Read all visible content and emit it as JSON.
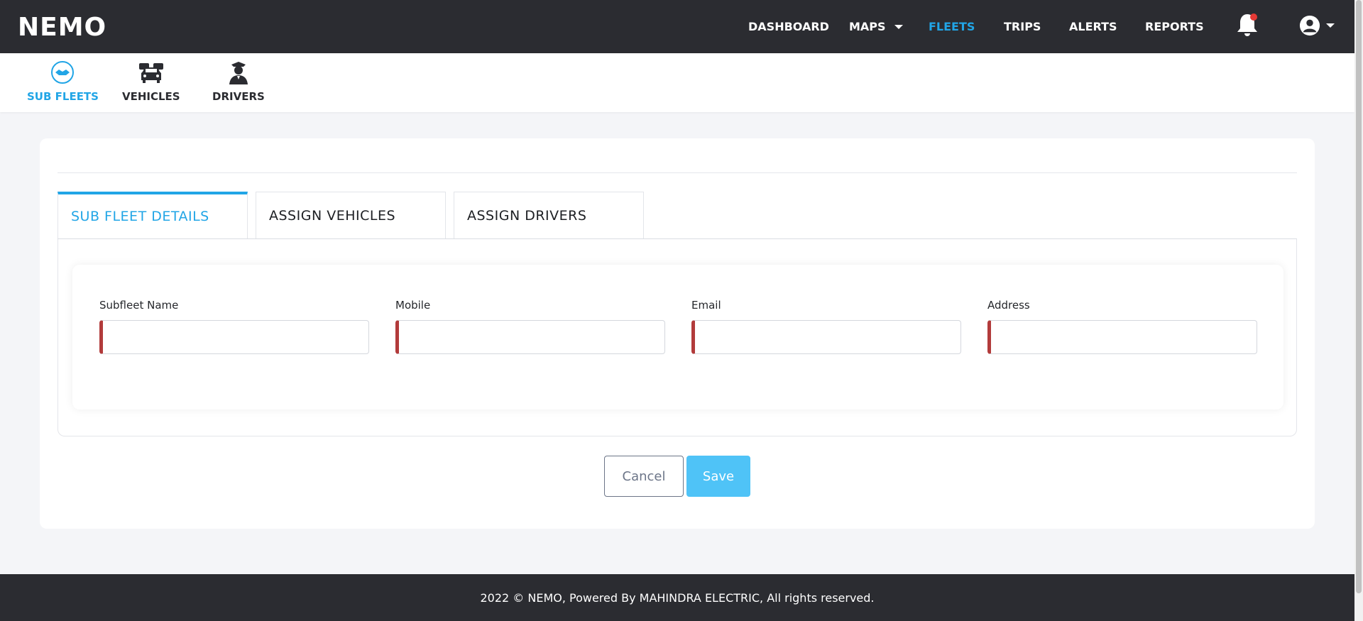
{
  "app": {
    "logo_text": "NEMO"
  },
  "topnav": {
    "items": [
      {
        "label": "DASHBOARD"
      },
      {
        "label": "MAPS"
      },
      {
        "label": "FLEETS"
      },
      {
        "label": "TRIPS"
      },
      {
        "label": "ALERTS"
      },
      {
        "label": "REPORTS"
      }
    ],
    "active": "FLEETS",
    "notification_icon": "bell-icon",
    "user_icon": "user-circle-icon"
  },
  "subnav": {
    "items": [
      {
        "label": "SUB FLEETS",
        "icon": "handshake-icon"
      },
      {
        "label": "VEHICLES",
        "icon": "vehicles-icon"
      },
      {
        "label": "DRIVERS",
        "icon": "driver-icon"
      }
    ],
    "active": "SUB FLEETS"
  },
  "tabs": {
    "items": [
      {
        "label": "SUB FLEET DETAILS"
      },
      {
        "label": "ASSIGN VEHICLES"
      },
      {
        "label": "ASSIGN DRIVERS"
      }
    ],
    "active": "SUB FLEET DETAILS"
  },
  "form": {
    "fields": [
      {
        "label": "Subfleet Name",
        "value": ""
      },
      {
        "label": "Mobile",
        "value": ""
      },
      {
        "label": "Email",
        "value": ""
      },
      {
        "label": "Address",
        "value": ""
      }
    ],
    "cancel_label": "Cancel",
    "save_label": "Save"
  },
  "footer": {
    "text": "2022 © NEMO, Powered By MAHINDRA ELECTRIC, All rights reserved."
  },
  "colors": {
    "accent": "#21a5e6",
    "navbar": "#2b2c31",
    "required_marker": "#b23b3b",
    "save_button": "#4fc3f7"
  }
}
